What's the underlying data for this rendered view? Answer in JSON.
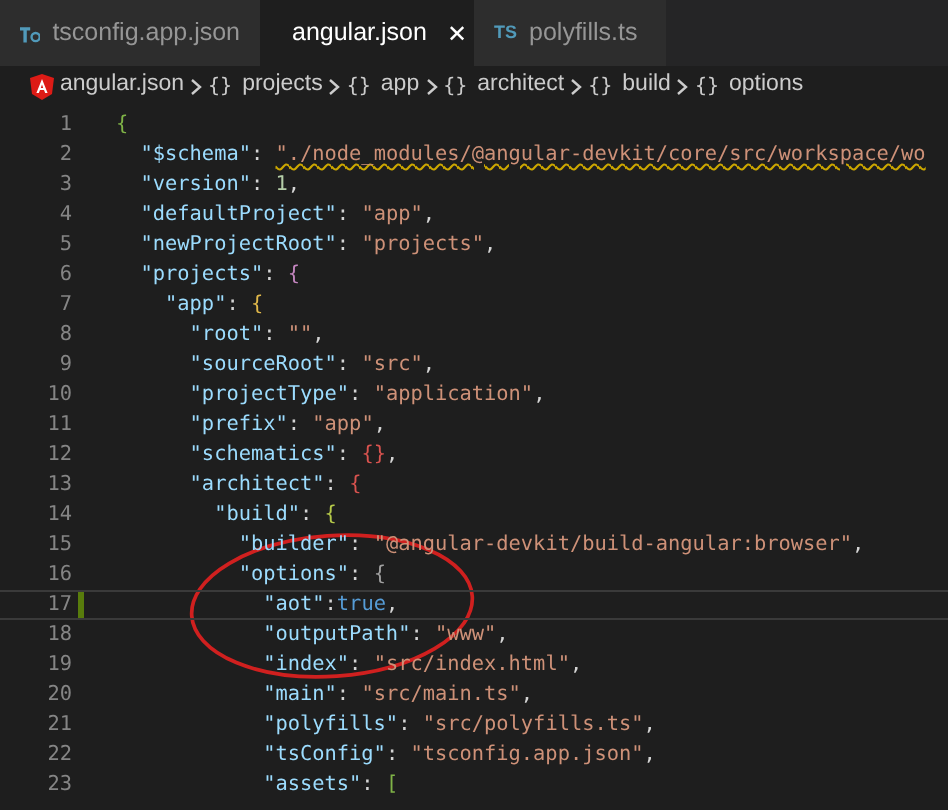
{
  "tabs": [
    {
      "label": "tsconfig.app.json",
      "kind": "tsconfig",
      "selected": false
    },
    {
      "label": "angular.json",
      "kind": "angular",
      "selected": true,
      "close_glyph": "✕"
    },
    {
      "label": "polyfills.ts",
      "kind": "ts",
      "icon_label": "TS",
      "selected": false
    }
  ],
  "breadcrumb": [
    {
      "label": "angular.json",
      "kind": "file"
    },
    {
      "label": "projects",
      "kind": "object",
      "symbol": "{}"
    },
    {
      "label": "app",
      "kind": "object",
      "symbol": "{}"
    },
    {
      "label": "architect",
      "kind": "object",
      "symbol": "{}"
    },
    {
      "label": "build",
      "kind": "object",
      "symbol": "{}"
    },
    {
      "label": "options",
      "kind": "object",
      "symbol": "{}"
    }
  ],
  "editor": {
    "lines": [
      {
        "number": "1",
        "current": false,
        "modified": false,
        "tokens": [
          {
            "kind": "bracket",
            "text": "{",
            "color": "#7fb347"
          }
        ]
      },
      {
        "number": "2",
        "current": false,
        "modified": false,
        "tokens": [
          {
            "kind": "key",
            "text": "  \"$schema\""
          },
          {
            "kind": "punct",
            "text": ": "
          },
          {
            "kind": "string",
            "text": "\"./node_modules/@angular-devkit/core/src/workspace/wo",
            "warning": true
          }
        ]
      },
      {
        "number": "3",
        "current": false,
        "modified": false,
        "tokens": [
          {
            "kind": "key",
            "text": "  \"version\""
          },
          {
            "kind": "punct",
            "text": ": "
          },
          {
            "kind": "number",
            "text": "1"
          },
          {
            "kind": "punct",
            "text": ","
          }
        ]
      },
      {
        "number": "4",
        "current": false,
        "modified": false,
        "tokens": [
          {
            "kind": "key",
            "text": "  \"defaultProject\""
          },
          {
            "kind": "punct",
            "text": ": "
          },
          {
            "kind": "string",
            "text": "\"app\""
          },
          {
            "kind": "punct",
            "text": ","
          }
        ]
      },
      {
        "number": "5",
        "current": false,
        "modified": false,
        "tokens": [
          {
            "kind": "key",
            "text": "  \"newProjectRoot\""
          },
          {
            "kind": "punct",
            "text": ": "
          },
          {
            "kind": "string",
            "text": "\"projects\""
          },
          {
            "kind": "punct",
            "text": ","
          }
        ]
      },
      {
        "number": "6",
        "current": false,
        "modified": false,
        "tokens": [
          {
            "kind": "key",
            "text": "  \"projects\""
          },
          {
            "kind": "punct",
            "text": ": "
          },
          {
            "kind": "bracket",
            "text": "{",
            "color": "#c586c0"
          }
        ]
      },
      {
        "number": "7",
        "current": false,
        "modified": false,
        "tokens": [
          {
            "kind": "key",
            "text": "    \"app\""
          },
          {
            "kind": "punct",
            "text": ": "
          },
          {
            "kind": "bracket",
            "text": "{",
            "color": "#e0b84a"
          }
        ]
      },
      {
        "number": "8",
        "current": false,
        "modified": false,
        "tokens": [
          {
            "kind": "key",
            "text": "      \"root\""
          },
          {
            "kind": "punct",
            "text": ": "
          },
          {
            "kind": "string",
            "text": "\"\""
          },
          {
            "kind": "punct",
            "text": ","
          }
        ]
      },
      {
        "number": "9",
        "current": false,
        "modified": false,
        "tokens": [
          {
            "kind": "key",
            "text": "      \"sourceRoot\""
          },
          {
            "kind": "punct",
            "text": ": "
          },
          {
            "kind": "string",
            "text": "\"src\""
          },
          {
            "kind": "punct",
            "text": ","
          }
        ]
      },
      {
        "number": "10",
        "current": false,
        "modified": false,
        "tokens": [
          {
            "kind": "key",
            "text": "      \"projectType\""
          },
          {
            "kind": "punct",
            "text": ": "
          },
          {
            "kind": "string",
            "text": "\"application\""
          },
          {
            "kind": "punct",
            "text": ","
          }
        ]
      },
      {
        "number": "11",
        "current": false,
        "modified": false,
        "tokens": [
          {
            "kind": "key",
            "text": "      \"prefix\""
          },
          {
            "kind": "punct",
            "text": ": "
          },
          {
            "kind": "string",
            "text": "\"app\""
          },
          {
            "kind": "punct",
            "text": ","
          }
        ]
      },
      {
        "number": "12",
        "current": false,
        "modified": false,
        "tokens": [
          {
            "kind": "key",
            "text": "      \"schematics\""
          },
          {
            "kind": "punct",
            "text": ": "
          },
          {
            "kind": "bracket",
            "text": "{}",
            "color": "#d9534f"
          },
          {
            "kind": "punct",
            "text": ","
          }
        ]
      },
      {
        "number": "13",
        "current": false,
        "modified": false,
        "tokens": [
          {
            "kind": "key",
            "text": "      \"architect\""
          },
          {
            "kind": "punct",
            "text": ": "
          },
          {
            "kind": "bracket",
            "text": "{",
            "color": "#d9534f"
          }
        ]
      },
      {
        "number": "14",
        "current": false,
        "modified": false,
        "tokens": [
          {
            "kind": "key",
            "text": "        \"build\""
          },
          {
            "kind": "punct",
            "text": ": "
          },
          {
            "kind": "bracket",
            "text": "{",
            "color": "#b5c94a"
          }
        ]
      },
      {
        "number": "15",
        "current": false,
        "modified": false,
        "tokens": [
          {
            "kind": "key",
            "text": "          \"builder\""
          },
          {
            "kind": "punct",
            "text": ": "
          },
          {
            "kind": "string",
            "text": "\"@angular-devkit/build-angular:browser\""
          },
          {
            "kind": "punct",
            "text": ","
          }
        ]
      },
      {
        "number": "16",
        "current": false,
        "modified": false,
        "tokens": [
          {
            "kind": "key",
            "text": "          \"options\""
          },
          {
            "kind": "punct",
            "text": ": "
          },
          {
            "kind": "bracket",
            "text": "{",
            "color": "#a0a0a0"
          }
        ]
      },
      {
        "number": "17",
        "current": true,
        "modified": true,
        "tokens": [
          {
            "kind": "key",
            "text": "            \"aot\""
          },
          {
            "kind": "punct",
            "text": ":"
          },
          {
            "kind": "boolean",
            "text": "true"
          },
          {
            "kind": "punct",
            "text": ","
          }
        ]
      },
      {
        "number": "18",
        "current": false,
        "modified": false,
        "tokens": [
          {
            "kind": "key",
            "text": "            \"outputPath\""
          },
          {
            "kind": "punct",
            "text": ": "
          },
          {
            "kind": "string",
            "text": "\"www\""
          },
          {
            "kind": "punct",
            "text": ","
          }
        ]
      },
      {
        "number": "19",
        "current": false,
        "modified": false,
        "tokens": [
          {
            "kind": "key",
            "text": "            \"index\""
          },
          {
            "kind": "punct",
            "text": ": "
          },
          {
            "kind": "string",
            "text": "\"src/index.html\""
          },
          {
            "kind": "punct",
            "text": ","
          }
        ]
      },
      {
        "number": "20",
        "current": false,
        "modified": false,
        "tokens": [
          {
            "kind": "key",
            "text": "            \"main\""
          },
          {
            "kind": "punct",
            "text": ": "
          },
          {
            "kind": "string",
            "text": "\"src/main.ts\""
          },
          {
            "kind": "punct",
            "text": ","
          }
        ]
      },
      {
        "number": "21",
        "current": false,
        "modified": false,
        "tokens": [
          {
            "kind": "key",
            "text": "            \"polyfills\""
          },
          {
            "kind": "punct",
            "text": ": "
          },
          {
            "kind": "string",
            "text": "\"src/polyfills.ts\""
          },
          {
            "kind": "punct",
            "text": ","
          }
        ]
      },
      {
        "number": "22",
        "current": false,
        "modified": false,
        "tokens": [
          {
            "kind": "key",
            "text": "            \"tsConfig\""
          },
          {
            "kind": "punct",
            "text": ": "
          },
          {
            "kind": "string",
            "text": "\"tsconfig.app.json\""
          },
          {
            "kind": "punct",
            "text": ","
          }
        ]
      },
      {
        "number": "23",
        "current": false,
        "modified": false,
        "tokens": [
          {
            "kind": "key",
            "text": "            \"assets\""
          },
          {
            "kind": "punct",
            "text": ": "
          },
          {
            "kind": "bracket",
            "text": "[",
            "color": "#7fb347"
          }
        ]
      }
    ]
  },
  "annotation": {
    "kind": "ellipse"
  }
}
